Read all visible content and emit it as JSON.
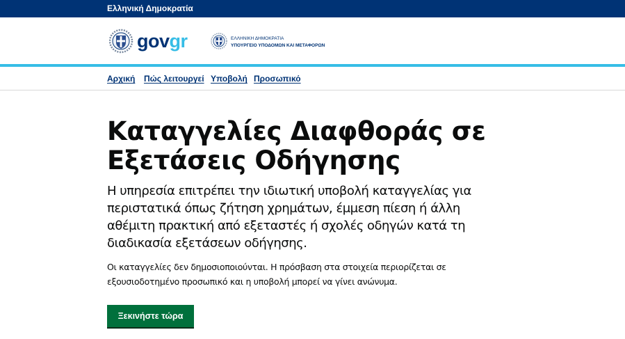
{
  "topbar": {
    "label": "Ελληνική Δημοκρατία"
  },
  "header": {
    "logo_text_gov": "gov",
    "logo_text_gr": "gr",
    "ministry_line1": "ΕΛΛΗΝΙΚΗ ΔΗΜΟΚΡΑΤΙΑ",
    "ministry_line2": "ΥΠΟΥΡΓΕΙΟ ΥΠΟΔΟΜΩΝ ΚΑΙ ΜΕΤΑΦΟΡΩΝ"
  },
  "nav": {
    "items": [
      {
        "label": "Αρχική"
      },
      {
        "label": "Πώς λειτουργεί"
      },
      {
        "label": "Υποβολή"
      },
      {
        "label": "Προσωπικό"
      }
    ]
  },
  "main": {
    "title": "Καταγγελίες Διαφθοράς σε Εξετάσεις Οδήγησης",
    "lead": "Η υπηρεσία επιτρέπει την ιδιωτική υποβολή καταγγελίας για περιστατικά όπως ζήτηση χρημάτων, έμμεση πίεση ή άλλη αθέμιτη πρακτική από εξεταστές ή σχολές οδηγών κατά τη διαδικασία εξετάσεων οδήγησης.",
    "body": "Οι καταγγελίες δεν δημοσιοποιούνται. Η πρόσβαση στα στοιχεία περιορίζεται σε εξουσιοδοτημένο προσωπικό και η υποβολή μπορεί να γίνει ανώνυμα.",
    "start_label": "Ξεκινήστε τώρα"
  },
  "colors": {
    "topbar": "#003375",
    "accent_rule": "#36bde6",
    "button": "#00703c",
    "nav_link": "#003375"
  },
  "icons": {
    "govgr_emblem": "greek-coat-of-arms-icon",
    "ministry_emblem": "greek-coat-of-arms-icon"
  }
}
